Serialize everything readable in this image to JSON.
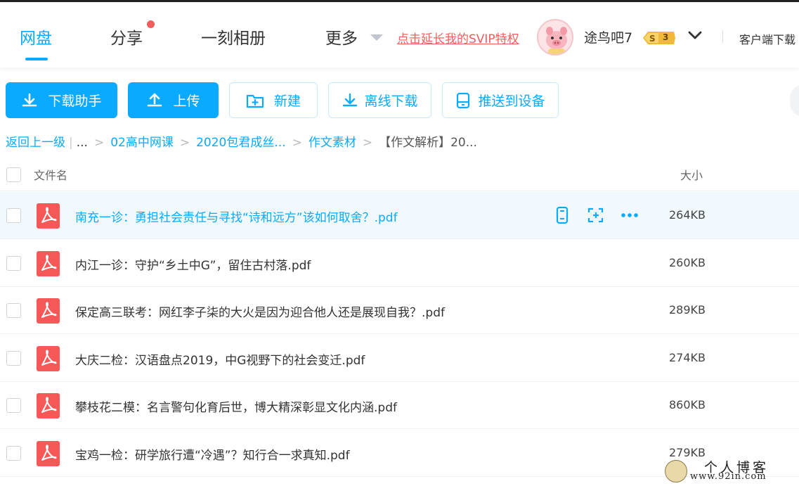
{
  "top_nav": {
    "items": [
      {
        "label": "网盘",
        "active": true
      },
      {
        "label": "分享",
        "active": false,
        "has_dot": true
      },
      {
        "label": "一刻相册",
        "active": false
      },
      {
        "label": "更多",
        "active": false
      }
    ],
    "svip_link": "点击延长我的SVIP特权",
    "username": "途鸟吧7",
    "vip_level": "3",
    "client_download": "客户端下载",
    "accent_color": "#09AAFF",
    "alert_color": "#f25d5d"
  },
  "toolbar": {
    "download_helper": "下载助手",
    "upload": "上传",
    "new_folder": "新建",
    "offline_download": "离线下载",
    "push_to_device": "推送到设备"
  },
  "breadcrumb": {
    "back": "返回上一级",
    "ellipsis": "...",
    "path": [
      "02高中网课",
      "2020包君成丝...",
      "作文素材"
    ],
    "current": "【作文解析】20..."
  },
  "table": {
    "col_name": "文件名",
    "col_size": "大小",
    "files": [
      {
        "name": "南充一诊：勇担社会责任与寻找“诗和远方”该如何取舍？.pdf",
        "size": "264KB"
      },
      {
        "name": "内江一诊：守护“乡土中G”，留住古村落.pdf",
        "size": "260KB"
      },
      {
        "name": "保定高三联考：网红李子柒的大火是因为迎合他人还是展现自我？.pdf",
        "size": "289KB"
      },
      {
        "name": "大庆二检：汉语盘点2019，中G视野下的社会变迁.pdf",
        "size": "274KB"
      },
      {
        "name": "攀枝花二模：名言警句化育后世，博大精深彰显文化内涵.pdf",
        "size": "860KB"
      },
      {
        "name": "宝鸡一检：研学旅行遭“冷遇”？知行合一求真知.pdf",
        "size": "279KB"
      }
    ]
  },
  "watermark": {
    "title": "个人博客",
    "url": "www.92in.com"
  },
  "icons": {
    "download": "download-icon",
    "upload": "upload-icon",
    "new_folder": "folder-plus-icon",
    "offline": "offline-download-icon",
    "device": "device-icon",
    "pdf": "pdf-file-icon",
    "phone": "phone-icon",
    "share": "share-icon",
    "more": "more-dots-icon"
  }
}
